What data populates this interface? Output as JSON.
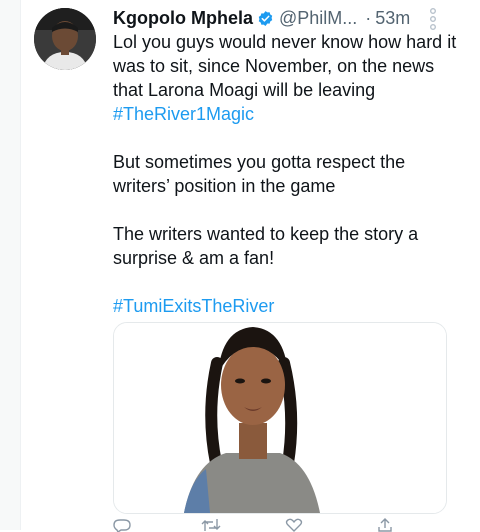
{
  "tweet": {
    "display_name": "Kgopolo Mphela",
    "handle": "@PhilM...",
    "separator": "·",
    "time": "53m",
    "paragraphs": [
      {
        "text": "Lol you guys would never know how hard it was to sit, since November, on the news that Larona Moagi will be leaving ",
        "hashtag": "#TheRiver1Magic"
      },
      {
        "text": "But sometimes you gotta respect the writers’ position in the game",
        "hashtag": ""
      },
      {
        "text": "The writers wanted to keep the story a surprise & am a fan!",
        "hashtag": ""
      },
      {
        "text": "",
        "hashtag": "#TumiExitsTheRiver"
      }
    ]
  },
  "icons": {
    "verified": "verified-badge-icon",
    "more": "more-options-icon",
    "reply": "reply-icon",
    "retweet": "retweet-icon",
    "like": "like-icon",
    "share": "share-icon"
  },
  "colors": {
    "link": "#1d9bf0",
    "verified": "#1d9bf0",
    "text": "#0f1419",
    "muted": "#536471"
  }
}
